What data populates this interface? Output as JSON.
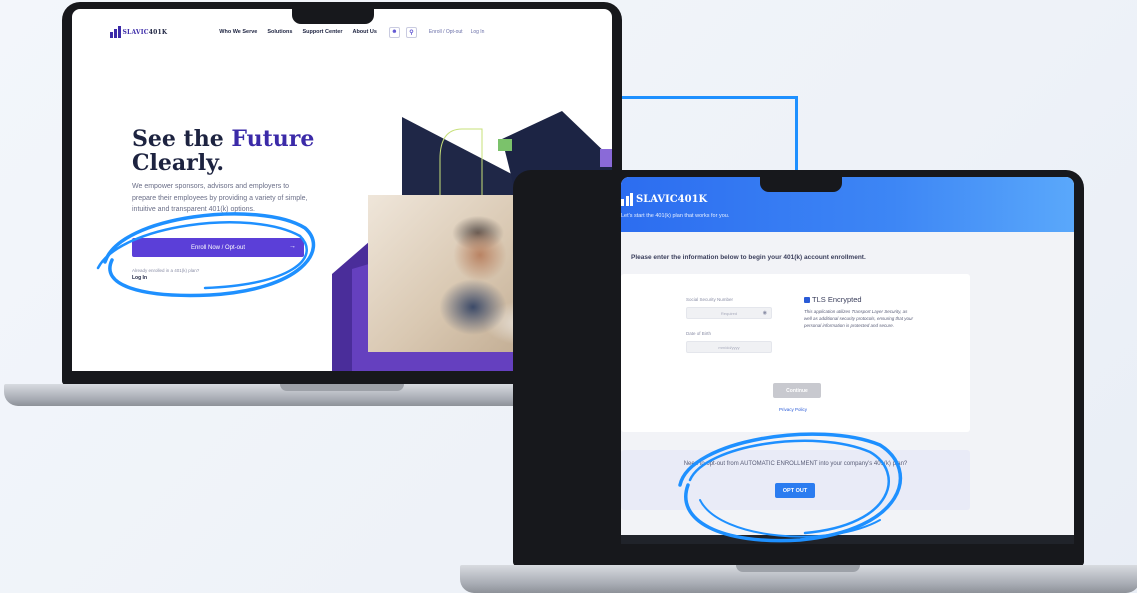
{
  "brand": {
    "slavic": "SLAVIC",
    "num": "401K",
    "full": "SLAVIC401K"
  },
  "site_header": {
    "nav": [
      "Who We Serve",
      "Solutions",
      "Support Center",
      "About Us"
    ],
    "links": [
      "Enroll / Opt-out",
      "Log In"
    ],
    "icons": [
      "person-icon",
      "search-icon"
    ]
  },
  "hero": {
    "title_line1_a": "See the ",
    "title_line1_b": "Future",
    "title_line2": "Clearly.",
    "paragraph": "We empower sponsors, advisors and employers to prepare their employees by providing a variety of simple, intuitive and transparent 401(k) options.",
    "enroll_button": "Enroll Now / Opt-out",
    "already": "Already enrolled in a 401(k) plan?",
    "login": "Log In"
  },
  "enrollment": {
    "tagline": "Let's start the 401(k) plan that works for you.",
    "instruction": "Please enter the information below to begin your 401(k) account enrollment.",
    "ssn_label": "Social Security Number",
    "ssn_placeholder": "Required",
    "dob_label": "Date of Birth",
    "dob_placeholder": "mm/dd/yyyy",
    "tls_title": "TLS Encrypted",
    "tls_text": "This application utilizes Transport Layer Security, as well as additional security protocols, ensuring that your personal information is protected and secure.",
    "continue": "Continue",
    "privacy": "Privacy Policy",
    "opt_question": "Need to opt-out from AUTOMATIC ENROLLMENT into your company's 401(k) plan?",
    "opt_button": "OPT OUT"
  },
  "colors": {
    "primary": "#5b3fd8",
    "navy": "#1d2340",
    "blue": "#2b7cf0",
    "highlight": "#1e90ff"
  }
}
